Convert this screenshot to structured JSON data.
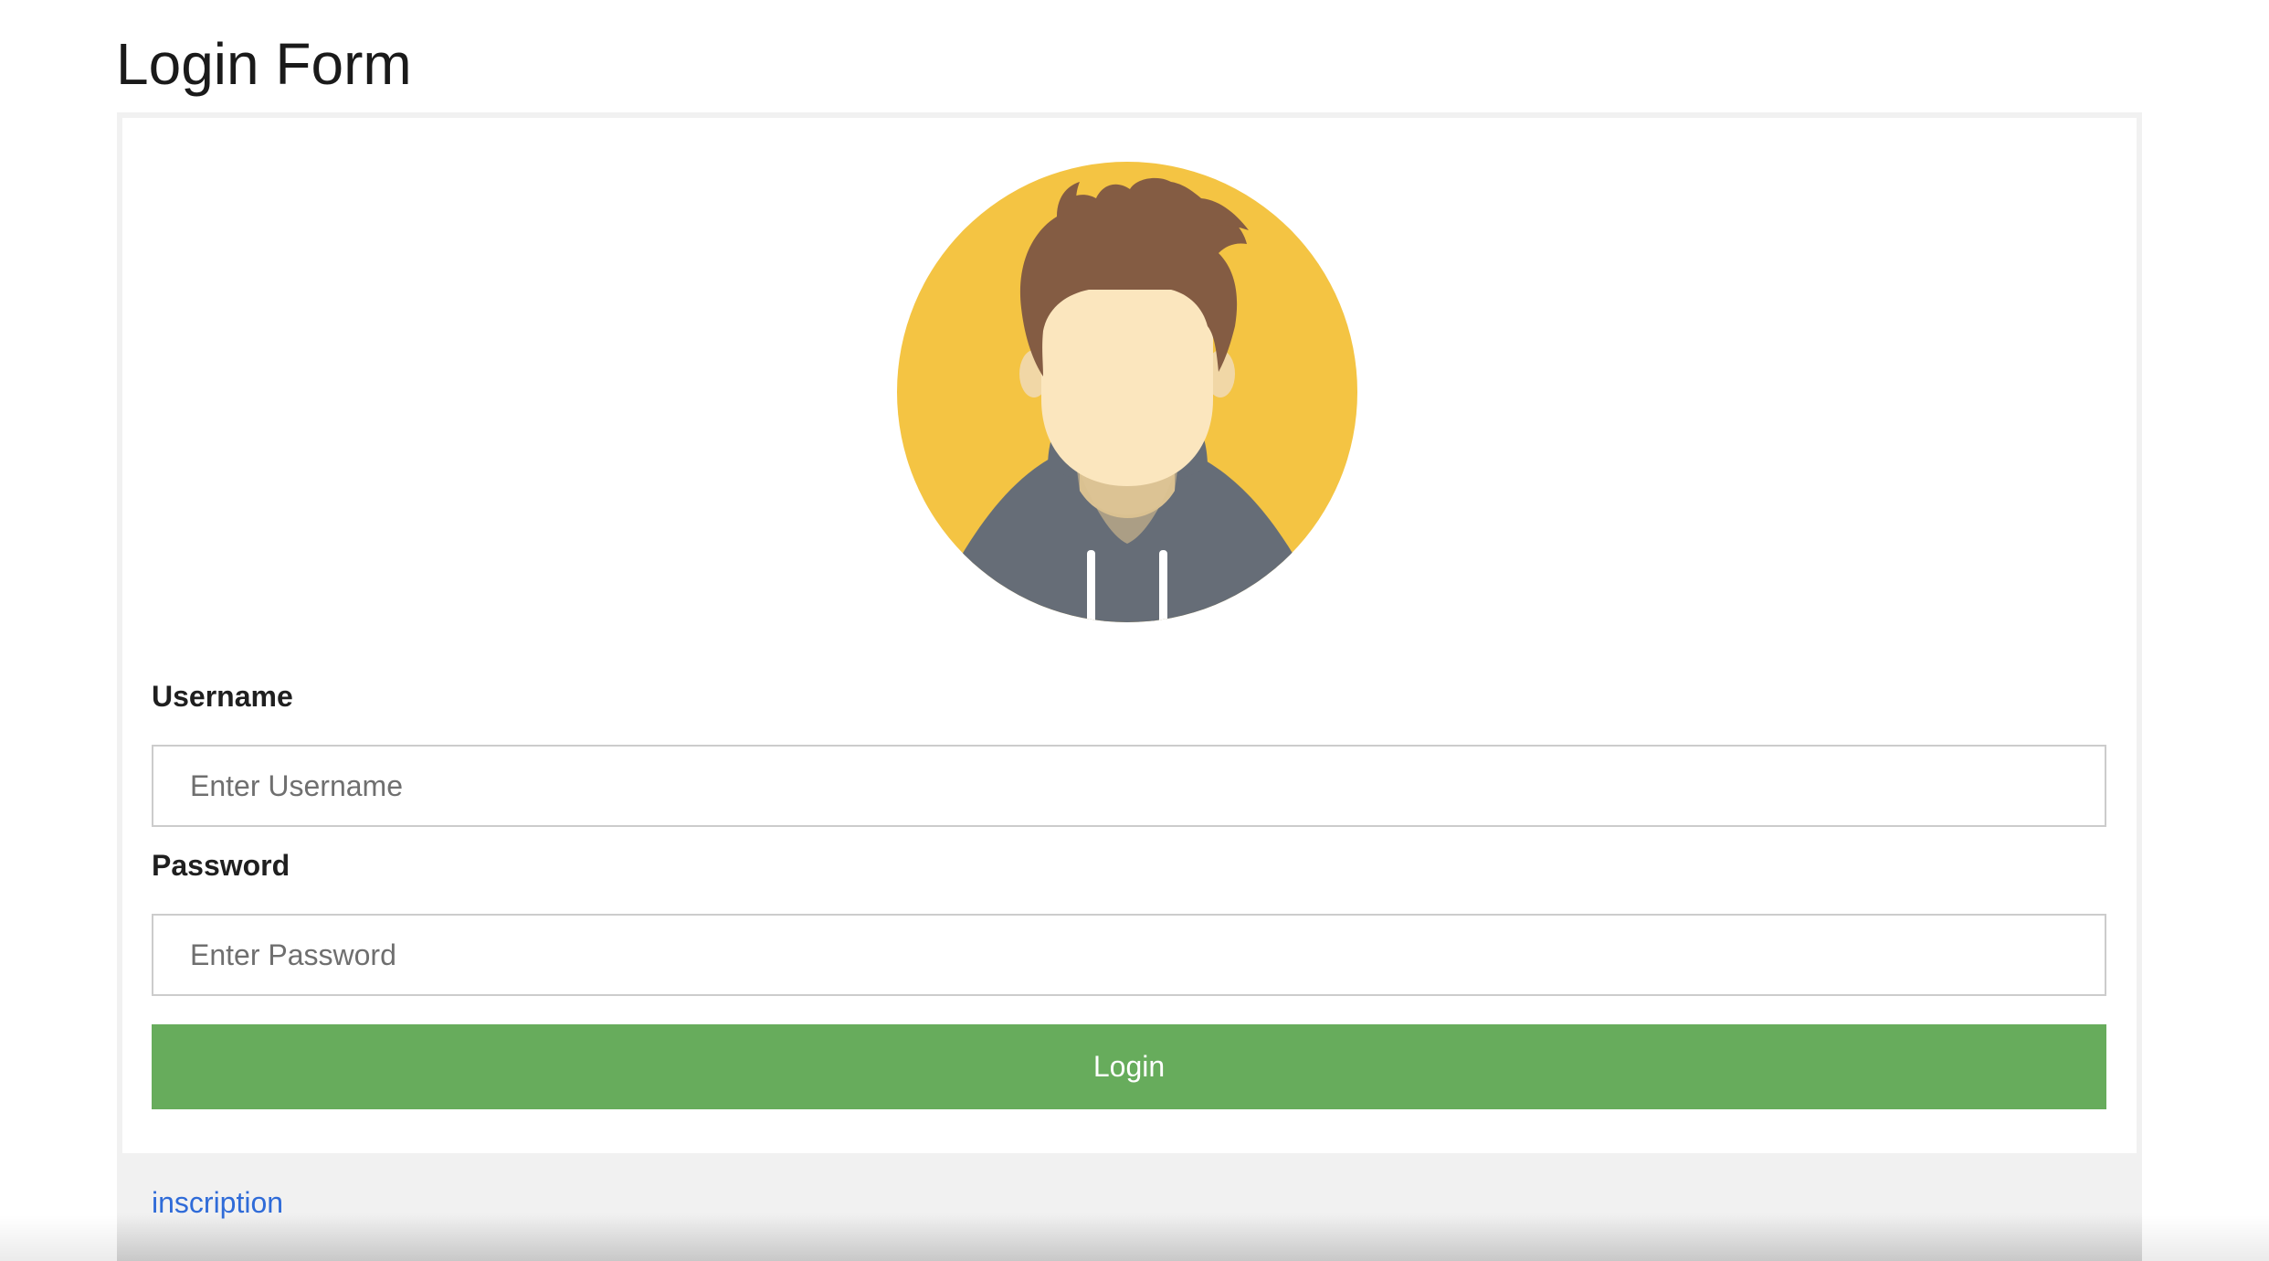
{
  "page": {
    "title": "Login Form"
  },
  "avatar": {
    "icon": "user-avatar-icon",
    "colors": {
      "background": "#f4c443",
      "hair": "#845c43",
      "skin": "#fbe6be",
      "hoodie": "#666d77"
    }
  },
  "form": {
    "username_label": "Username",
    "username_placeholder": "Enter Username",
    "username_value": "",
    "password_label": "Password",
    "password_placeholder": "Enter Password",
    "password_value": "",
    "login_label": "Login",
    "login_color": "#67ac5c"
  },
  "footer": {
    "link_label": "inscription",
    "link_color": "#2f6bd8"
  }
}
